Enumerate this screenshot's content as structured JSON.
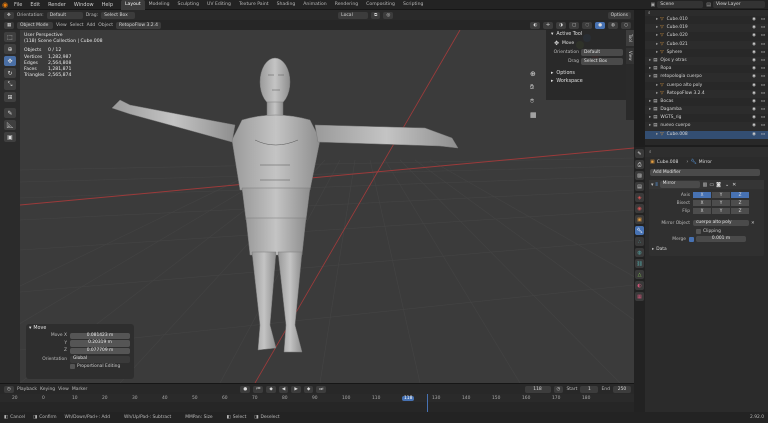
{
  "menubar": {
    "menus": [
      "File",
      "Edit",
      "Render",
      "Window",
      "Help"
    ],
    "workspaces": [
      "Layout",
      "Modeling",
      "Sculpting",
      "UV Editing",
      "Texture Paint",
      "Shading",
      "Animation",
      "Rendering",
      "Compositing",
      "Scripting"
    ],
    "scene_label": "Scene",
    "view_layer_label": "View Layer"
  },
  "tool_header": {
    "orientation_label": "Orientation:",
    "orientation_value": "Default",
    "drag_label": "Drag:",
    "drag_value": "Select Box",
    "transform_value": "Local",
    "options_label": "Options"
  },
  "viewport_header": {
    "mode": "Object Mode",
    "menus": [
      "View",
      "Select",
      "Add",
      "Object",
      "RetopoFlow 3.2.4"
    ]
  },
  "viewport_overlay": {
    "view_name": "User Perspective",
    "collection": "(118) Scene Collection | Cube.008",
    "stats": [
      {
        "label": "Objects",
        "value": "0 / 12"
      },
      {
        "label": "Vertices",
        "value": "1,282,987"
      },
      {
        "label": "Edges",
        "value": "2,564,808"
      },
      {
        "label": "Faces",
        "value": "1,281,871"
      },
      {
        "label": "Triangles",
        "value": "2,565,874"
      }
    ]
  },
  "npanel": {
    "active_tool": "Active Tool",
    "tool_name": "Move",
    "orientation_label": "Orientation",
    "orientation_value": "Default",
    "drag_label": "Drag",
    "drag_value": "Select Box",
    "options": "Options",
    "workspace": "Workspace",
    "tabs": [
      "Tool",
      "View"
    ]
  },
  "move_panel": {
    "title": "Move",
    "move_x_label": "Move X",
    "move_x": "0.081423 m",
    "y_label": "Y",
    "y": "0.20319 m",
    "z_label": "Z",
    "z": "0.077709 m",
    "orientation_label": "Orientation",
    "orientation_value": "Global",
    "proportional": "Proportional Editing"
  },
  "outliner": {
    "items": [
      {
        "name": "Cube.010",
        "indent": 1
      },
      {
        "name": "Cube.019",
        "indent": 1
      },
      {
        "name": "Cube.020",
        "indent": 1
      },
      {
        "name": "Cube.021",
        "indent": 1
      },
      {
        "name": "Sphere",
        "indent": 1
      },
      {
        "name": "Ojos y otras",
        "indent": 0
      },
      {
        "name": "Ropa",
        "indent": 0
      },
      {
        "name": "retopologia cuerpo",
        "indent": 0
      },
      {
        "name": "cuerpo alto poly",
        "indent": 1
      },
      {
        "name": "RetopoFlow 3.2.4",
        "indent": 1
      },
      {
        "name": "Bocas",
        "indent": 0
      },
      {
        "name": "Dagamba",
        "indent": 0
      },
      {
        "name": "WGTS_rig",
        "indent": 0
      },
      {
        "name": "nuevo cuerpo",
        "indent": 0
      },
      {
        "name": "Cube.008",
        "indent": 1
      }
    ]
  },
  "properties": {
    "object_name": "Cube.008",
    "modifier_breadcrumb": "Mirror",
    "add_modifier": "Add Modifier",
    "modifier_name": "Mirror",
    "axis_label": "Axis",
    "bisect_label": "Bisect",
    "flip_label": "Flip",
    "axes": [
      "X",
      "Y",
      "Z"
    ],
    "mirror_object_label": "Mirror Object",
    "mirror_object_value": "cuerpo alto poly",
    "clipping_label": "Clipping",
    "merge_label": "Merge",
    "merge_value": "0.001 m",
    "data_label": "Data"
  },
  "timeline": {
    "menus": [
      "Playback",
      "Keying",
      "View",
      "Marker"
    ],
    "current_frame": "118",
    "start_label": "Start",
    "start": "1",
    "end_label": "End",
    "end": "250",
    "ticks": [
      "20",
      "0",
      "10",
      "20",
      "30",
      "40",
      "50",
      "60",
      "70",
      "80",
      "90",
      "100",
      "110",
      "118",
      "130",
      "140",
      "150",
      "160",
      "170",
      "180"
    ]
  },
  "statusbar": {
    "items": [
      "Cancel",
      "Confirm",
      "Wh/Down/Pad+: Add",
      "Wh/Up/Pad-: Subtract",
      "MMPan: Size",
      "Select",
      "Deselect"
    ],
    "version": "2.92.0"
  },
  "colors": {
    "accent": "#4772b3",
    "orange": "#e87d0d",
    "x_axis": "#c0392b",
    "y_axis": "#7aa832"
  }
}
